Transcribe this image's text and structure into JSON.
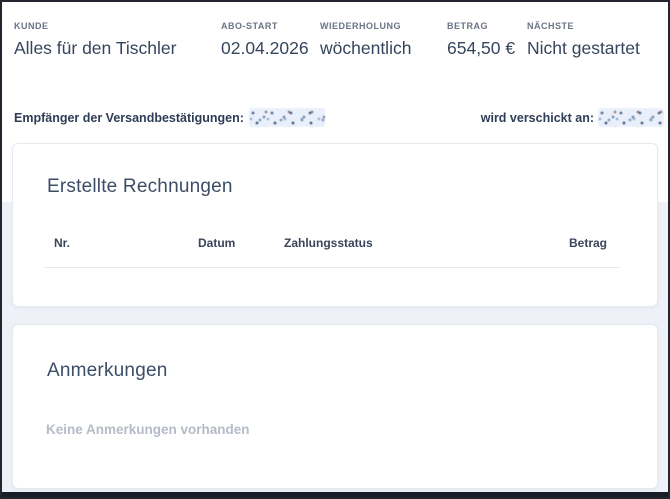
{
  "subscription_summary": {
    "columns": [
      {
        "label": "KUNDE",
        "value": "Alles für den Tischler"
      },
      {
        "label": "ABO-START",
        "value": "02.04.2026"
      },
      {
        "label": "WIEDERHOLUNG",
        "value": "wöchentlich"
      },
      {
        "label": "BETRAG",
        "value": "654,50 €"
      },
      {
        "label": "NÄCHSTE",
        "value": "Nicht gestartet"
      }
    ]
  },
  "recipients_row": {
    "label": "Empfänger der Versandbestätigungen:",
    "value_redacted": true,
    "send_to_label": "wird verschickt an:",
    "send_to_value_redacted": true
  },
  "invoices_card": {
    "title": "Erstellte Rechnungen",
    "table_headers": [
      "Nr.",
      "Datum",
      "Zahlungsstatus",
      "Betrag"
    ],
    "rows": []
  },
  "notes_card": {
    "title": "Anmerkungen",
    "empty_message": "Keine Anmerkungen vorhanden"
  },
  "colors": {
    "value_text": "#36455e",
    "muted_label": "#6a7484",
    "placeholder_text": "#b4bbc6",
    "section_background": "#eef1f7",
    "dark_bottom_bar": "#191d28",
    "card_border": "#e6e9f0"
  }
}
